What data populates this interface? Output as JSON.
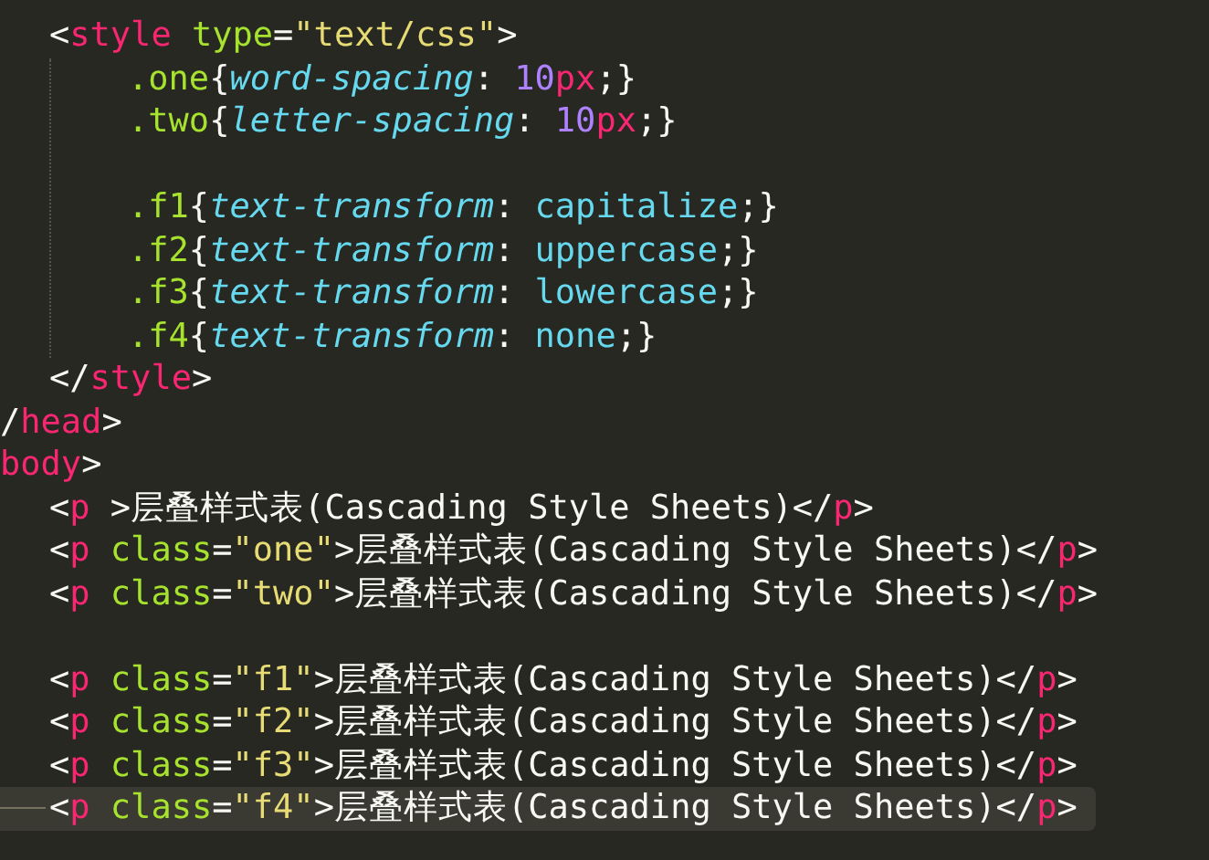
{
  "lines": [
    {
      "kind": "code",
      "clipped": false,
      "current": false,
      "tokens": [
        {
          "kind": "punct",
          "text": "<"
        },
        {
          "kind": "tag",
          "text": "style "
        },
        {
          "kind": "attr",
          "text": "type"
        },
        {
          "kind": "punct",
          "text": "="
        },
        {
          "kind": "string",
          "text": "\"text/css\""
        },
        {
          "kind": "punct",
          "text": ">"
        }
      ],
      "children": [
        {
          "kind": "code",
          "tokens": [
            {
              "kind": "selector",
              "text": ".one"
            },
            {
              "kind": "punct",
              "text": "{"
            },
            {
              "kind": "prop",
              "text": "word-spacing"
            },
            {
              "kind": "punct",
              "text": ": "
            },
            {
              "kind": "number",
              "text": "10"
            },
            {
              "kind": "unit",
              "text": "px"
            },
            {
              "kind": "punct",
              "text": ";}"
            }
          ]
        },
        {
          "kind": "code",
          "tokens": [
            {
              "kind": "selector",
              "text": ".two"
            },
            {
              "kind": "punct",
              "text": "{"
            },
            {
              "kind": "prop",
              "text": "letter-spacing"
            },
            {
              "kind": "punct",
              "text": ": "
            },
            {
              "kind": "number",
              "text": "10"
            },
            {
              "kind": "unit",
              "text": "px"
            },
            {
              "kind": "punct",
              "text": ";}"
            }
          ]
        },
        {
          "kind": "blank"
        },
        {
          "kind": "code",
          "tokens": [
            {
              "kind": "selector",
              "text": ".f1"
            },
            {
              "kind": "punct",
              "text": "{"
            },
            {
              "kind": "prop",
              "text": "text-transform"
            },
            {
              "kind": "punct",
              "text": ": "
            },
            {
              "kind": "value",
              "text": "capitalize"
            },
            {
              "kind": "punct",
              "text": ";}"
            }
          ]
        },
        {
          "kind": "code",
          "tokens": [
            {
              "kind": "selector",
              "text": ".f2"
            },
            {
              "kind": "punct",
              "text": "{"
            },
            {
              "kind": "prop",
              "text": "text-transform"
            },
            {
              "kind": "punct",
              "text": ": "
            },
            {
              "kind": "value",
              "text": "uppercase"
            },
            {
              "kind": "punct",
              "text": ";}"
            }
          ]
        },
        {
          "kind": "code",
          "tokens": [
            {
              "kind": "selector",
              "text": ".f3"
            },
            {
              "kind": "punct",
              "text": "{"
            },
            {
              "kind": "prop",
              "text": "text-transform"
            },
            {
              "kind": "punct",
              "text": ": "
            },
            {
              "kind": "value",
              "text": "lowercase"
            },
            {
              "kind": "punct",
              "text": ";}"
            }
          ]
        },
        {
          "kind": "code",
          "tokens": [
            {
              "kind": "selector",
              "text": ".f4"
            },
            {
              "kind": "punct",
              "text": "{"
            },
            {
              "kind": "prop",
              "text": "text-transform"
            },
            {
              "kind": "punct",
              "text": ": "
            },
            {
              "kind": "value",
              "text": "none"
            },
            {
              "kind": "punct",
              "text": ";}"
            }
          ]
        }
      ]
    },
    {
      "kind": "code",
      "clipped": false,
      "current": false,
      "tokens": [
        {
          "kind": "punct",
          "text": "</"
        },
        {
          "kind": "tag",
          "text": "style"
        },
        {
          "kind": "punct",
          "text": ">"
        }
      ]
    },
    {
      "kind": "code",
      "clipped": true,
      "current": false,
      "tokens": [
        {
          "kind": "punct",
          "text": "/"
        },
        {
          "kind": "tag",
          "text": "head"
        },
        {
          "kind": "punct",
          "text": ">"
        }
      ]
    },
    {
      "kind": "code",
      "clipped": true,
      "current": false,
      "tokens": [
        {
          "kind": "tag",
          "text": "body"
        },
        {
          "kind": "punct",
          "text": ">"
        }
      ]
    },
    {
      "kind": "code",
      "clipped": false,
      "current": false,
      "tokens": [
        {
          "kind": "punct",
          "text": "<"
        },
        {
          "kind": "tag",
          "text": "p"
        },
        {
          "kind": "punct",
          "text": " >层叠样式表(Cascading Style Sheets)</"
        },
        {
          "kind": "tag",
          "text": "p"
        },
        {
          "kind": "punct",
          "text": ">"
        }
      ]
    },
    {
      "kind": "code",
      "clipped": false,
      "current": false,
      "tokens": [
        {
          "kind": "punct",
          "text": "<"
        },
        {
          "kind": "tag",
          "text": "p "
        },
        {
          "kind": "attr",
          "text": "class"
        },
        {
          "kind": "punct",
          "text": "="
        },
        {
          "kind": "string",
          "text": "\"one\""
        },
        {
          "kind": "punct",
          "text": ">层叠样式表(Cascading Style Sheets)</"
        },
        {
          "kind": "tag",
          "text": "p"
        },
        {
          "kind": "punct",
          "text": ">"
        }
      ]
    },
    {
      "kind": "code",
      "clipped": false,
      "current": false,
      "tokens": [
        {
          "kind": "punct",
          "text": "<"
        },
        {
          "kind": "tag",
          "text": "p "
        },
        {
          "kind": "attr",
          "text": "class"
        },
        {
          "kind": "punct",
          "text": "="
        },
        {
          "kind": "string",
          "text": "\"two\""
        },
        {
          "kind": "punct",
          "text": ">层叠样式表(Cascading Style Sheets)</"
        },
        {
          "kind": "tag",
          "text": "p"
        },
        {
          "kind": "punct",
          "text": ">"
        }
      ]
    },
    {
      "kind": "blank"
    },
    {
      "kind": "code",
      "clipped": false,
      "current": false,
      "tokens": [
        {
          "kind": "punct",
          "text": "<"
        },
        {
          "kind": "tag",
          "text": "p "
        },
        {
          "kind": "attr",
          "text": "class"
        },
        {
          "kind": "punct",
          "text": "="
        },
        {
          "kind": "string",
          "text": "\"f1\""
        },
        {
          "kind": "punct",
          "text": ">层叠样式表(Cascading Style Sheets)</"
        },
        {
          "kind": "tag",
          "text": "p"
        },
        {
          "kind": "punct",
          "text": ">"
        }
      ]
    },
    {
      "kind": "code",
      "clipped": false,
      "current": false,
      "tokens": [
        {
          "kind": "punct",
          "text": "<"
        },
        {
          "kind": "tag",
          "text": "p "
        },
        {
          "kind": "attr",
          "text": "class"
        },
        {
          "kind": "punct",
          "text": "="
        },
        {
          "kind": "string",
          "text": "\"f2\""
        },
        {
          "kind": "punct",
          "text": ">层叠样式表(Cascading Style Sheets)</"
        },
        {
          "kind": "tag",
          "text": "p"
        },
        {
          "kind": "punct",
          "text": ">"
        }
      ]
    },
    {
      "kind": "code",
      "clipped": false,
      "current": false,
      "tokens": [
        {
          "kind": "punct",
          "text": "<"
        },
        {
          "kind": "tag",
          "text": "p "
        },
        {
          "kind": "attr",
          "text": "class"
        },
        {
          "kind": "punct",
          "text": "="
        },
        {
          "kind": "string",
          "text": "\"f3\""
        },
        {
          "kind": "punct",
          "text": ">层叠样式表(Cascading Style Sheets)</"
        },
        {
          "kind": "tag",
          "text": "p"
        },
        {
          "kind": "punct",
          "text": ">"
        }
      ]
    },
    {
      "kind": "code",
      "clipped": false,
      "current": true,
      "tokens": [
        {
          "kind": "punct",
          "text": "<"
        },
        {
          "kind": "tag",
          "text": "p "
        },
        {
          "kind": "attr",
          "text": "class"
        },
        {
          "kind": "punct",
          "text": "="
        },
        {
          "kind": "string",
          "text": "\"f4\""
        },
        {
          "kind": "punct",
          "text": ">层叠样式表(Cascading Style Sheets)</"
        },
        {
          "kind": "tag",
          "text": "p"
        },
        {
          "kind": "punct",
          "text": ">"
        }
      ]
    }
  ]
}
